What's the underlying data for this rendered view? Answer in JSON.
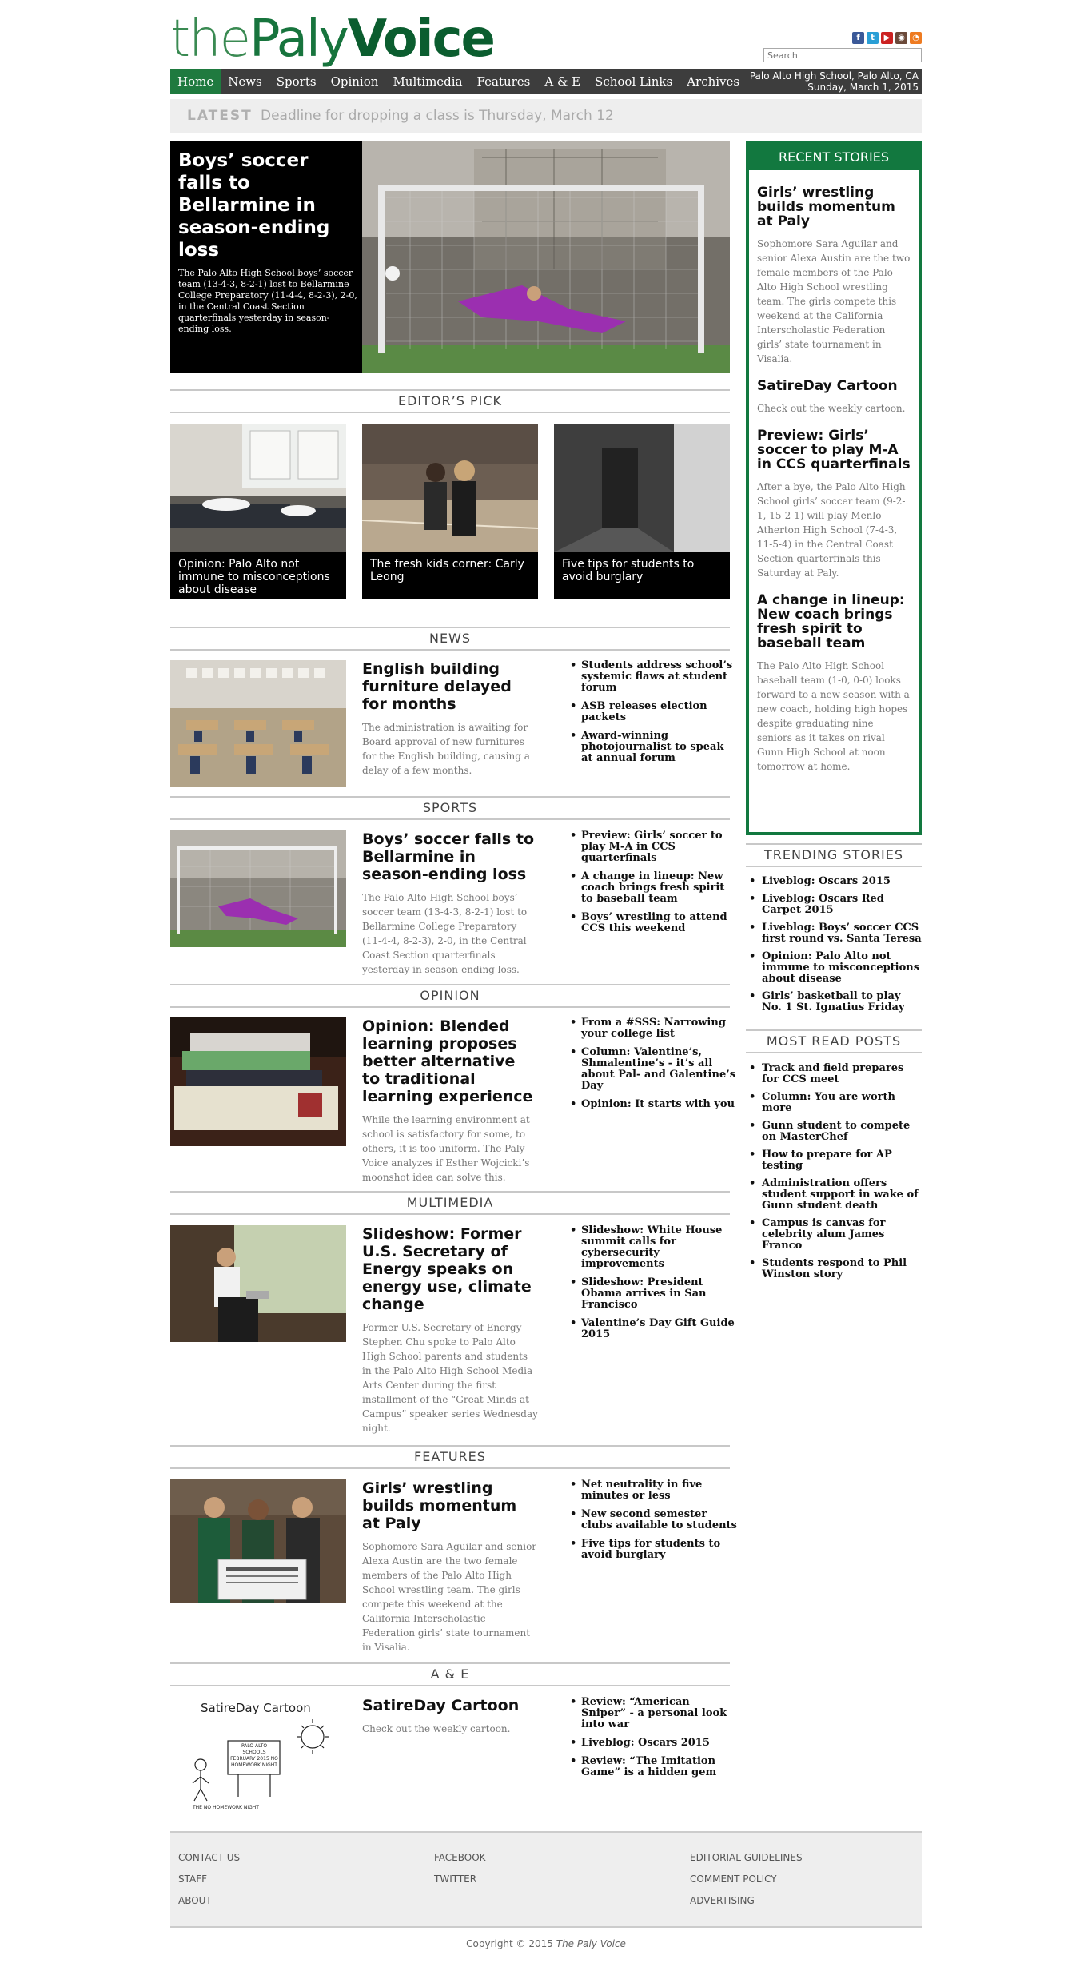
{
  "logo": {
    "part1": "the",
    "part2": "Paly",
    "part3": "Voice"
  },
  "social_icons": [
    "facebook-icon",
    "twitter-icon",
    "youtube-icon",
    "instagram-icon",
    "rss-icon"
  ],
  "search": {
    "placeholder": "Search"
  },
  "nav": {
    "items": [
      "Home",
      "News",
      "Sports",
      "Opinion",
      "Multimedia",
      "Features",
      "A & E",
      "School Links",
      "Archives"
    ],
    "location": "Palo Alto High School, Palo Alto, CA",
    "date": "Sunday, March 1, 2015"
  },
  "latest": {
    "label": "LATEST",
    "text": "Deadline for dropping a class is Thursday, March 12"
  },
  "hero": {
    "title": "Boys’ soccer falls to Bellarmine in season-ending loss",
    "summary": "The Palo Alto High School boys’ soccer team (13-4-3, 8-2-1) lost to Bellarmine College Preparatory (11-4-4, 8-2-3), 2-0, in the Central Coast Section quarterfinals yesterday in season-ending loss."
  },
  "editors_pick": {
    "heading": "EDITOR’S PICK",
    "items": [
      "Opinion: Palo Alto not immune to misconceptions about disease",
      "The fresh kids corner: Carly Leong",
      "Five tips for students to avoid burglary"
    ]
  },
  "news": {
    "heading": "NEWS",
    "title": "English building furniture delayed for months",
    "summary": "The administration is awaiting for Board approval of new furnitures for the English building, causing a delay of a few months.",
    "links": [
      "Students address school’s systemic flaws at student forum",
      "ASB releases election packets",
      "Award-winning photojournalist to speak at annual forum"
    ]
  },
  "sports": {
    "heading": "SPORTS",
    "title": "Boys’ soccer falls to Bellarmine in season-ending loss",
    "summary": "The Palo Alto High School boys’ soccer team (13-4-3, 8-2-1) lost to Bellarmine College Preparatory (11-4-4, 8-2-3), 2-0, in the Central Coast Section quarterfinals yesterday in season-ending loss.",
    "links": [
      "Preview: Girls’ soccer to play M-A in CCS quarterfinals",
      "A change in lineup: New coach brings fresh spirit to baseball team",
      "Boys’ wrestling to attend CCS this weekend"
    ]
  },
  "opinion": {
    "heading": "OPINION",
    "title": "Opinion: Blended learning proposes better alternative to traditional learning experience",
    "summary": "While the learning environment at school is satisfactory for some, to others, it is too uniform. The Paly Voice analyzes if Esther Wojcicki’s moonshot idea can solve this.",
    "links": [
      "From a #SSS: Narrowing your college list",
      "Column: Valentine’s, Shmalentine’s - it’s all about Pal- and Galentine’s Day",
      "Opinion: It starts with you"
    ]
  },
  "multimedia": {
    "heading": "MULTIMEDIA",
    "title": "Slideshow: Former U.S. Secretary of Energy speaks on energy use, climate change",
    "summary": "Former U.S. Secretary of Energy Stephen Chu spoke to Palo Alto High School parents and students in the Palo Alto High School Media Arts Center during the first installment of the “Great Minds at Campus” speaker series Wednesday night.",
    "links": [
      "Slideshow: White House summit calls for cybersecurity improvements",
      "Slideshow: President Obama arrives in San Francisco",
      "Valentine’s Day Gift Guide 2015"
    ]
  },
  "features": {
    "heading": "FEATURES",
    "title": "Girls’ wrestling builds momentum at Paly",
    "summary": "Sophomore Sara Aguilar and senior Alexa Austin are the two female members of the Palo Alto High School wrestling team. The girls compete this weekend at the California Interscholastic Federation girls’ state tournament in Visalia.",
    "links": [
      "Net neutrality in five minutes or less",
      "New second semester clubs available to students",
      "Five tips for students to avoid burglary"
    ]
  },
  "ae": {
    "heading": "A & E",
    "title": "SatireDay Cartoon",
    "summary": "Check out the weekly cartoon.",
    "links": [
      "Review: “American Sniper” - a personal look into war",
      "Liveblog: Oscars 2015",
      "Review: “The Imitation Game” is a hidden gem"
    ],
    "cartoon_text": "SatireDay Cartoon",
    "cartoon_sign": "PALO ALTO SCHOOLS FEBRUARY 2015 NO HOMEWORK NIGHT",
    "cartoon_caption": "THE NO HOMEWORK NIGHT"
  },
  "recent": {
    "heading": "RECENT STORIES",
    "items": [
      {
        "title": "Girls’ wrestling builds momentum at Paly",
        "summary": "Sophomore Sara Aguilar and senior Alexa Austin are the two female members of the Palo Alto High School wrestling team. The girls compete this weekend at the California Interscholastic Federation girls’ state tournament in Visalia."
      },
      {
        "title": "SatireDay Cartoon",
        "summary": "Check out the weekly cartoon."
      },
      {
        "title": "Preview: Girls’ soccer to play M-A in CCS quarterfinals",
        "summary": "After a bye, the Palo Alto High School girls’ soccer team (9-2-1, 15-2-1) will play Menlo-Atherton High School (7-4-3, 11-5-4) in the Central Coast Section quarterfinals this Saturday at Paly."
      },
      {
        "title": "A change in lineup: New coach brings fresh spirit to baseball team",
        "summary": "The Palo Alto High School baseball team (1-0, 0-0) looks forward to a new season with a new coach, holding high hopes despite graduating nine seniors as it takes on rival Gunn High School at noon tomorrow at home."
      }
    ]
  },
  "trending": {
    "heading": "TRENDING STORIES",
    "items": [
      "Liveblog: Oscars 2015",
      "Liveblog: Oscars Red Carpet 2015",
      "Liveblog: Boys’ soccer CCS first round vs. Santa Teresa",
      "Opinion: Palo Alto not immune to misconceptions about disease",
      "Girls’ basketball to play No. 1 St. Ignatius Friday"
    ]
  },
  "most_read": {
    "heading": "MOST READ POSTS",
    "items": [
      "Track and field prepares for CCS meet",
      "Column: You are worth more",
      "Gunn student to compete on MasterChef",
      "How to prepare for AP testing",
      "Administration offers student support in wake of Gunn student death",
      "Campus is canvas for celebrity alum James Franco",
      "Students respond to Phil Winston story"
    ]
  },
  "footer": {
    "col1": [
      "CONTACT US",
      "STAFF",
      "ABOUT"
    ],
    "col2": [
      "FACEBOOK",
      "TWITTER"
    ],
    "col3": [
      "EDITORIAL GUIDELINES",
      "COMMENT POLICY",
      "ADVERTISING"
    ],
    "copyright_prefix": "Copyright © 2015",
    "copyright_name": "The Paly Voice"
  },
  "colors": {
    "brand_green": "#12783f",
    "nav_bg": "#3d3d3d",
    "latest_bg": "#eeeeee"
  }
}
